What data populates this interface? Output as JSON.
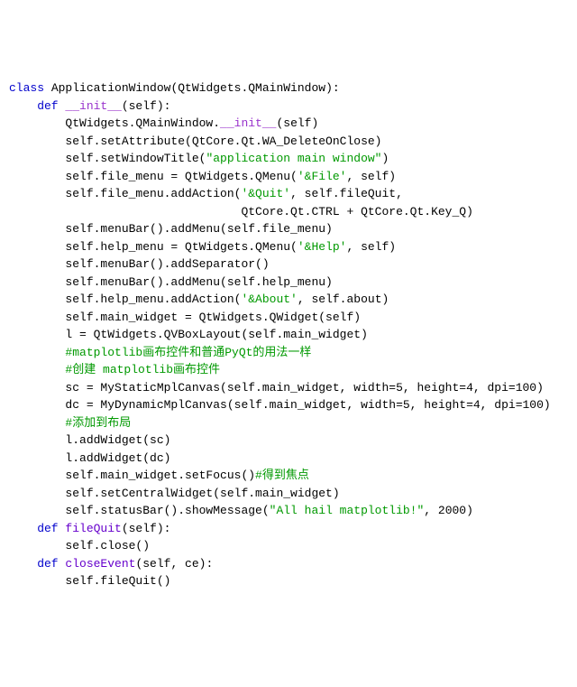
{
  "code": {
    "line01_class": "class",
    "line01_name": " ApplicationWindow(QtWidgets.QMainWindow):",
    "line02_def": "    def",
    "line02_init": " __init__",
    "line02_rest": "(self):",
    "line03": "        QtWidgets.QMainWindow.",
    "line03_init": "__init__",
    "line03_rest": "(self)",
    "line04": "        self.setAttribute(QtCore.Qt.WA_DeleteOnClose)",
    "line05_a": "        self.setWindowTitle(",
    "line05_str": "\"application main window\"",
    "line05_b": ")",
    "blank1": "",
    "line06_a": "        self.file_menu = QtWidgets.QMenu(",
    "line06_str": "'&File'",
    "line06_b": ", self)",
    "line07_a": "        self.file_menu.addAction(",
    "line07_str": "'&Quit'",
    "line07_b": ", self.fileQuit,",
    "line08": "                                 QtCore.Qt.CTRL + QtCore.Qt.Key_Q)",
    "line09": "        self.menuBar().addMenu(self.file_menu)",
    "blank2": "",
    "line10_a": "        self.help_menu = QtWidgets.QMenu(",
    "line10_str": "'&Help'",
    "line10_b": ", self)",
    "line11": "        self.menuBar().addSeparator()",
    "line12": "        self.menuBar().addMenu(self.help_menu)",
    "blank3": "",
    "line13_a": "        self.help_menu.addAction(",
    "line13_str": "'&About'",
    "line13_b": ", self.about)",
    "blank4": "",
    "line14": "        self.main_widget = QtWidgets.QWidget(self)",
    "blank5": "",
    "line15": "        l = QtWidgets.QVBoxLayout(self.main_widget)",
    "blank6": "",
    "cmt1": "        #matplotlib画布控件和普通PyQt的用法一样",
    "cmt2": "        #创建 matplotlib画布控件",
    "line16": "        sc = MyStaticMplCanvas(self.main_widget, width=5, height=4, dpi=100)",
    "line17": "        dc = MyDynamicMplCanvas(self.main_widget, width=5, height=4, dpi=100)",
    "blank7": "",
    "cmt3": "        #添加到布局",
    "line18": "        l.addWidget(sc)",
    "line19": "        l.addWidget(dc)",
    "blank8": "",
    "line20_a": "        self.main_widget.setFocus()",
    "line20_cmt": "#得到焦点",
    "line21": "        self.setCentralWidget(self.main_widget)",
    "blank9": "",
    "line22_a": "        self.statusBar().showMessage(",
    "line22_str": "\"All hail matplotlib!\"",
    "line22_b": ", 2000)",
    "blank10": "",
    "line23_def": "    def",
    "line23_fn": " fileQuit",
    "line23_rest": "(self):",
    "line24": "        self.close()",
    "blank11": "",
    "line25_def": "    def",
    "line25_fn": " closeEvent",
    "line25_rest": "(self, ce):",
    "line26": "        self.fileQuit()"
  }
}
